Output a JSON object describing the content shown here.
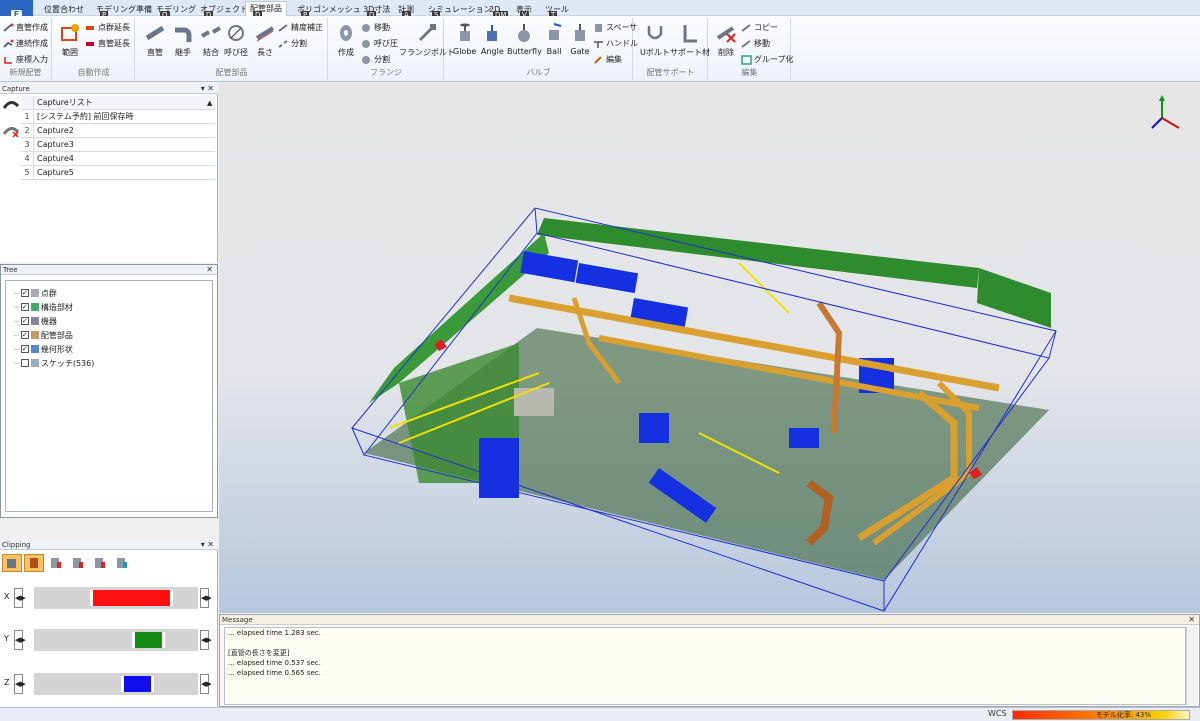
{
  "menu": {
    "file": "F",
    "tabs": [
      {
        "label": "位置合わせ",
        "key": ""
      },
      {
        "label": "モデリング準備",
        "key": "P"
      },
      {
        "label": "モデリング",
        "key": "O"
      },
      {
        "label": "オブジェクト",
        "key": "D"
      },
      {
        "label": "配管部品",
        "key": "D"
      },
      {
        "label": "ポリゴンメッシュ",
        "key": "P"
      },
      {
        "label": "3D寸法",
        "key": "D"
      },
      {
        "label": "計測",
        "key": "A"
      },
      {
        "label": "シミュレーション",
        "key": "S"
      },
      {
        "label": "2D",
        "key": "DM"
      },
      {
        "label": "表示",
        "key": "V"
      },
      {
        "label": "ツール",
        "key": "T"
      }
    ],
    "active_tab": "配管部品"
  },
  "ribbon": {
    "g1": {
      "label": "新規配管",
      "items": [
        "直管作成",
        "連続作成",
        "座標入力"
      ]
    },
    "g2": {
      "label": "自動作成",
      "big": "範囲",
      "items": [
        "点群延長",
        "直管延長"
      ]
    },
    "g3": {
      "label": "配管部品",
      "bigs": [
        "直管",
        "継手",
        "結合",
        "呼び径",
        "長さ"
      ],
      "items": [
        "精度補正",
        "分割"
      ]
    },
    "g4": {
      "label": "フランジ",
      "big": "作成",
      "items": [
        "移動",
        "呼び圧",
        "分割"
      ],
      "big2": "フランジボルト"
    },
    "g5": {
      "label": "バルブ",
      "bigs": [
        "Globe",
        "Angle",
        "Butterfly",
        "Ball",
        "Gate"
      ],
      "items": [
        "スペーサ",
        "ハンドル",
        "編集"
      ]
    },
    "g6": {
      "label": "配管サポート",
      "bigs": [
        "Uボルト",
        "サポート材"
      ]
    },
    "g7": {
      "label": "編集",
      "big": "削除",
      "items": [
        "コピー",
        "移動",
        "グループ化"
      ]
    }
  },
  "capture": {
    "title": "Capture",
    "header": "Captureリスト",
    "rows": [
      {
        "n": "1",
        "name": "[システム予約] 前回保存時"
      },
      {
        "n": "2",
        "name": "Capture2"
      },
      {
        "n": "3",
        "name": "Capture3"
      },
      {
        "n": "4",
        "name": "Capture4"
      },
      {
        "n": "5",
        "name": "Capture5"
      }
    ]
  },
  "tree": {
    "title": "Tree",
    "items": [
      {
        "label": "点群",
        "checked": true
      },
      {
        "label": "構造部材",
        "checked": true
      },
      {
        "label": "機器",
        "checked": true
      },
      {
        "label": "配管部品",
        "checked": true
      },
      {
        "label": "幾何形状",
        "checked": true
      },
      {
        "label": "スケッチ(536)",
        "checked": false
      }
    ]
  },
  "clipping": {
    "title": "Clipping",
    "sliders": [
      {
        "axis": "X",
        "start": 0.34,
        "end": 0.85,
        "color": "#ff1010"
      },
      {
        "axis": "Y",
        "start": 0.6,
        "end": 0.8,
        "color": "#138a13"
      },
      {
        "axis": "Z",
        "start": 0.53,
        "end": 0.73,
        "color": "#1010ee"
      }
    ]
  },
  "message": {
    "title": "Message",
    "lines": [
      "... elapsed time 1.283 sec.",
      "",
      "[直管の長さを変更]",
      "... elapsed time 0.537 sec.",
      "... elapsed time 0.565 sec."
    ]
  },
  "status": {
    "wcs": "WCS",
    "progress_label": "モデル化率: 43%",
    "progress": 0.43
  }
}
